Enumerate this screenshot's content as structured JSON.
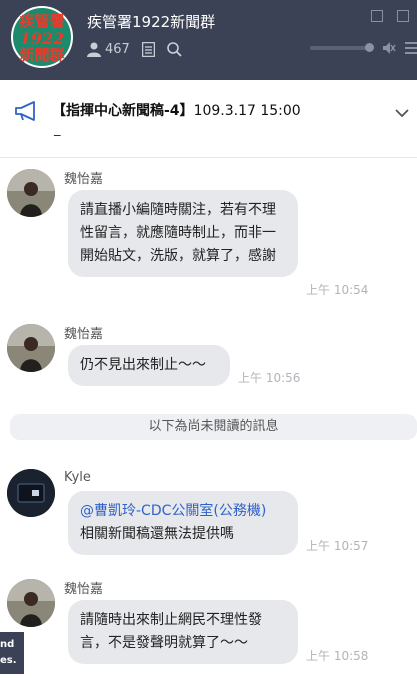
{
  "header": {
    "group_avatar_lines": [
      "疾管署",
      "1922",
      "新聞群"
    ],
    "title": "疾管署1922新聞群",
    "member_count": "467",
    "icons": [
      "person-icon",
      "note-icon",
      "search-icon",
      "mute-icon",
      "menu-icon"
    ]
  },
  "announcement": {
    "text": "【指揮中心新聞稿-4】",
    "date": "109.3.17  15:00",
    "continuation": "_"
  },
  "messages": [
    {
      "sender": "魏怡嘉",
      "text": "請直播小編隨時關注，若有不理性留言，就應隨時制止，而非一開始貼文，洗版，就算了，感謝",
      "time": "上午 10:54"
    },
    {
      "sender": "魏怡嘉",
      "text": "仍不見出來制止～～",
      "time": "上午 10:56"
    },
    {
      "sender": "Kyle",
      "mention": "@曹凱玲-CDC公關室(公務機)",
      "text": "相關新聞稿還無法提供嗎",
      "time": "上午 10:57"
    },
    {
      "sender": "魏怡嘉",
      "text": "請隨時出來制止網民不理性發言，不是發聲明就算了～～",
      "time": "上午 10:58"
    }
  ],
  "unread_divider": "以下為尚未閱讀的訊息",
  "overlay_text": [
    "nd",
    "es."
  ],
  "colors": {
    "header_bg": "#3b4256",
    "bubble_bg": "#e6e8ec",
    "mention": "#2f62c8",
    "avatar_group_bg": "#1e8a6c",
    "avatar_group_text": "#e63b2e"
  }
}
